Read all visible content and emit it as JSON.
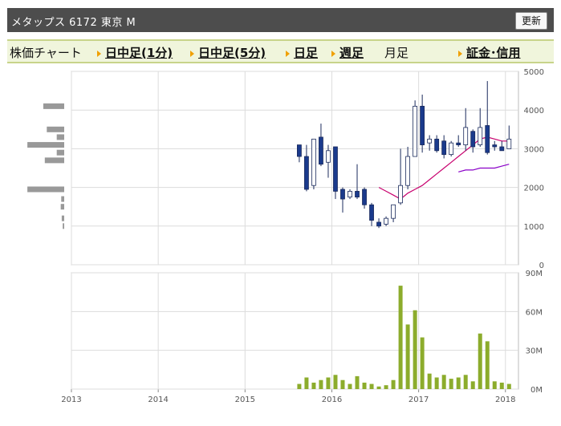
{
  "header": {
    "title": "メタップス 6172 東京 M",
    "refresh_label": "更新"
  },
  "tabs": [
    {
      "label": "株価チャート",
      "link": false,
      "arrow": false
    },
    {
      "label": "日中足(1分)",
      "link": true,
      "arrow": true
    },
    {
      "label": "日中足(5分)",
      "link": true,
      "arrow": true
    },
    {
      "label": "日足",
      "link": true,
      "arrow": true
    },
    {
      "label": "週足",
      "link": true,
      "arrow": true
    },
    {
      "label": "月足",
      "link": false,
      "arrow": false
    },
    {
      "label": "証金･信用",
      "link": true,
      "arrow": true
    }
  ],
  "colors": {
    "up": "#ffffff",
    "down": "#1a3a8c",
    "ma_short": "#c8006e",
    "ma_long": "#8a00c8",
    "volume": "#8cac2c",
    "profile": "#999999"
  },
  "chart_data": [
    {
      "type": "candlestick",
      "title": "",
      "x_ticks": [
        "2013",
        "2014",
        "2015",
        "2016",
        "2017",
        "2018"
      ],
      "ylim": [
        0,
        5000
      ],
      "y_ticks": [
        0,
        1000,
        2000,
        3000,
        4000,
        5000
      ],
      "y_tick_labels": [
        "0",
        "1000",
        "2000",
        "3000",
        "4000",
        "5000"
      ],
      "candles": [
        {
          "x": "2015-08",
          "open": 3100,
          "high": 3100,
          "low": 2650,
          "close": 2800
        },
        {
          "x": "2015-09",
          "open": 2800,
          "high": 3100,
          "low": 1900,
          "close": 1950
        },
        {
          "x": "2015-10",
          "open": 2050,
          "high": 3250,
          "low": 1950,
          "close": 3250
        },
        {
          "x": "2015-11",
          "open": 3300,
          "high": 3650,
          "low": 2550,
          "close": 2600
        },
        {
          "x": "2015-12",
          "open": 2650,
          "high": 3100,
          "low": 2250,
          "close": 2950
        },
        {
          "x": "2016-01",
          "open": 3050,
          "high": 3050,
          "low": 1700,
          "close": 1900
        },
        {
          "x": "2016-02",
          "open": 1950,
          "high": 2000,
          "low": 1350,
          "close": 1700
        },
        {
          "x": "2016-03",
          "open": 1750,
          "high": 1950,
          "low": 1700,
          "close": 1900
        },
        {
          "x": "2016-04",
          "open": 1900,
          "high": 2600,
          "low": 1700,
          "close": 1750
        },
        {
          "x": "2016-05",
          "open": 1950,
          "high": 2000,
          "low": 1450,
          "close": 1550
        },
        {
          "x": "2016-06",
          "open": 1550,
          "high": 1600,
          "low": 1000,
          "close": 1150
        },
        {
          "x": "2016-07",
          "open": 1100,
          "high": 1200,
          "low": 950,
          "close": 1000
        },
        {
          "x": "2016-08",
          "open": 1050,
          "high": 1250,
          "low": 1000,
          "close": 1200
        },
        {
          "x": "2016-09",
          "open": 1200,
          "high": 1550,
          "low": 1100,
          "close": 1550
        },
        {
          "x": "2016-10",
          "open": 1600,
          "high": 3000,
          "low": 1550,
          "close": 2050
        },
        {
          "x": "2016-11",
          "open": 2050,
          "high": 3050,
          "low": 1950,
          "close": 2800
        },
        {
          "x": "2016-12",
          "open": 2800,
          "high": 4250,
          "low": 2800,
          "close": 4100
        },
        {
          "x": "2017-01",
          "open": 4100,
          "high": 4400,
          "low": 2900,
          "close": 3100
        },
        {
          "x": "2017-02",
          "open": 3150,
          "high": 3350,
          "low": 2950,
          "close": 3250
        },
        {
          "x": "2017-03",
          "open": 3250,
          "high": 3350,
          "low": 2900,
          "close": 2950
        },
        {
          "x": "2017-04",
          "open": 3200,
          "high": 3350,
          "low": 2750,
          "close": 2850
        },
        {
          "x": "2017-05",
          "open": 2850,
          "high": 3200,
          "low": 2800,
          "close": 3150
        },
        {
          "x": "2017-06",
          "open": 3150,
          "high": 3350,
          "low": 3050,
          "close": 3100
        },
        {
          "x": "2017-07",
          "open": 3100,
          "high": 4050,
          "low": 2950,
          "close": 3550
        },
        {
          "x": "2017-08",
          "open": 3450,
          "high": 3500,
          "low": 2900,
          "close": 3050
        },
        {
          "x": "2017-09",
          "open": 3100,
          "high": 4050,
          "low": 3050,
          "close": 3550
        },
        {
          "x": "2017-10",
          "open": 3600,
          "high": 4750,
          "low": 2850,
          "close": 2900
        },
        {
          "x": "2017-11",
          "open": 3100,
          "high": 3200,
          "low": 2950,
          "close": 3050
        },
        {
          "x": "2017-12",
          "open": 3050,
          "high": 3200,
          "low": 2950,
          "close": 2950
        },
        {
          "x": "2018-01",
          "open": 3000,
          "high": 3600,
          "low": 3000,
          "close": 3250
        }
      ],
      "ma_short": [
        {
          "x": "2016-07",
          "y": 2000
        },
        {
          "x": "2016-08",
          "y": 1900
        },
        {
          "x": "2016-09",
          "y": 1800
        },
        {
          "x": "2016-10",
          "y": 1700
        },
        {
          "x": "2016-11",
          "y": 1850
        },
        {
          "x": "2016-12",
          "y": 1950
        },
        {
          "x": "2017-01",
          "y": 2050
        },
        {
          "x": "2017-02",
          "y": 2200
        },
        {
          "x": "2017-03",
          "y": 2350
        },
        {
          "x": "2017-04",
          "y": 2500
        },
        {
          "x": "2017-05",
          "y": 2650
        },
        {
          "x": "2017-06",
          "y": 2800
        },
        {
          "x": "2017-07",
          "y": 2950
        },
        {
          "x": "2017-08",
          "y": 3100
        },
        {
          "x": "2017-09",
          "y": 3250
        },
        {
          "x": "2017-10",
          "y": 3300
        },
        {
          "x": "2017-11",
          "y": 3250
        },
        {
          "x": "2017-12",
          "y": 3200
        },
        {
          "x": "2018-01",
          "y": 3200
        }
      ],
      "ma_long": [
        {
          "x": "2017-06",
          "y": 2400
        },
        {
          "x": "2017-07",
          "y": 2450
        },
        {
          "x": "2017-08",
          "y": 2450
        },
        {
          "x": "2017-09",
          "y": 2500
        },
        {
          "x": "2017-10",
          "y": 2500
        },
        {
          "x": "2017-11",
          "y": 2500
        },
        {
          "x": "2017-12",
          "y": 2550
        },
        {
          "x": "2018-01",
          "y": 2600
        }
      ],
      "volume_profile": [
        {
          "price": 4100,
          "value": 0.42
        },
        {
          "price": 3500,
          "value": 0.35
        },
        {
          "price": 3300,
          "value": 0.15
        },
        {
          "price": 3100,
          "value": 0.74
        },
        {
          "price": 2900,
          "value": 0.15
        },
        {
          "price": 2700,
          "value": 0.39
        },
        {
          "price": 1950,
          "value": 0.74
        },
        {
          "price": 1700,
          "value": 0.06
        },
        {
          "price": 1500,
          "value": 0.07
        },
        {
          "price": 1200,
          "value": 0.05
        },
        {
          "price": 1000,
          "value": 0.03
        }
      ]
    },
    {
      "type": "bar",
      "title": "",
      "ylim": [
        0,
        90
      ],
      "y_ticks": [
        0,
        30,
        60,
        90
      ],
      "y_tick_labels": [
        "0M",
        "30M",
        "60M",
        "90M"
      ],
      "x": [
        "2015-08",
        "2015-09",
        "2015-10",
        "2015-11",
        "2015-12",
        "2016-01",
        "2016-02",
        "2016-03",
        "2016-04",
        "2016-05",
        "2016-06",
        "2016-07",
        "2016-08",
        "2016-09",
        "2016-10",
        "2016-11",
        "2016-12",
        "2017-01",
        "2017-02",
        "2017-03",
        "2017-04",
        "2017-05",
        "2017-06",
        "2017-07",
        "2017-08",
        "2017-09",
        "2017-10",
        "2017-11",
        "2017-12",
        "2018-01"
      ],
      "values": [
        4,
        9,
        5,
        7,
        9,
        11,
        7,
        4,
        10,
        5,
        4,
        2,
        3,
        7,
        80,
        50,
        61,
        40,
        12,
        9,
        11,
        8,
        9,
        11,
        6,
        43,
        37,
        6,
        5,
        4
      ]
    }
  ]
}
